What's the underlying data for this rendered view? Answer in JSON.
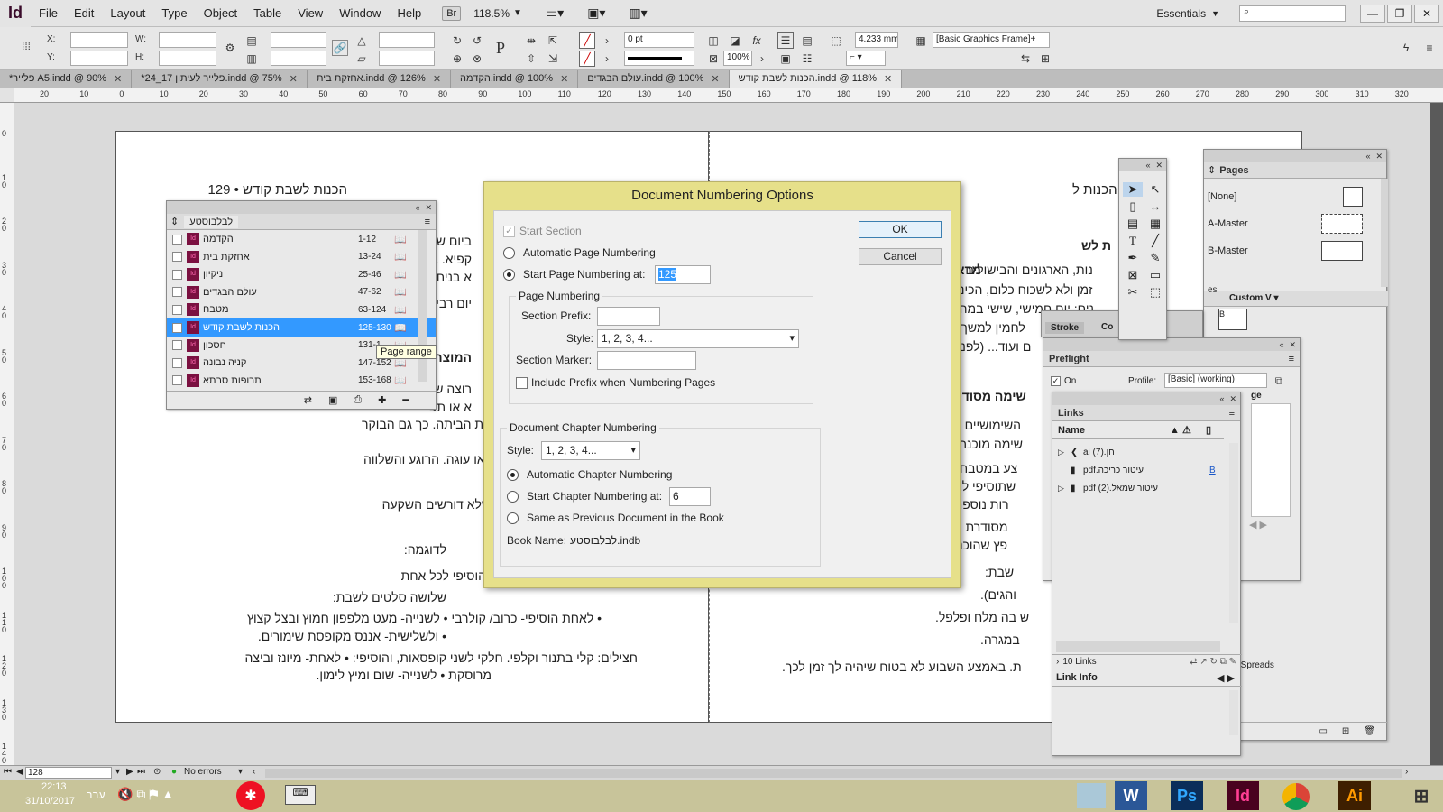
{
  "menubar": {
    "logo": "Id",
    "items": [
      "File",
      "Edit",
      "Layout",
      "Type",
      "Object",
      "Table",
      "View",
      "Window",
      "Help"
    ],
    "br_chip": "Br",
    "zoom": "118.5%",
    "workspace": "Essentials",
    "win_min": "—",
    "win_restore": "❐",
    "win_close": "✕"
  },
  "control": {
    "x_label": "X:",
    "y_label": "Y:",
    "w_label": "W:",
    "h_label": "H:",
    "stroke_weight": "0 pt",
    "opacity": "100%",
    "fitting_value": "4.233 mm",
    "object_style": "[Basic Graphics Frame]+"
  },
  "tabs": [
    {
      "label": "*פלייר A5.indd @ 90%",
      "active": false
    },
    {
      "label": "*24_17 פלייר לעיתון.indd @ 75%",
      "active": false
    },
    {
      "label": "אחזקת בית.indd @ 126%",
      "active": false
    },
    {
      "label": "הקדמה.indd @ 100%",
      "active": false
    },
    {
      "label": "עולם הבגדים.indd @ 100%",
      "active": false
    },
    {
      "label": "הכנות לשבת קודש.indd @ 118%",
      "active": true
    }
  ],
  "hruler": [
    "20",
    "10",
    "0",
    "10",
    "20",
    "30",
    "40",
    "50",
    "60",
    "70",
    "80",
    "90",
    "100",
    "110",
    "120",
    "130",
    "140",
    "150",
    "160",
    "170",
    "180",
    "190",
    "200",
    "210",
    "220",
    "230",
    "240",
    "250",
    "260",
    "270",
    "280",
    "290",
    "300",
    "310",
    "320"
  ],
  "vruler": [
    "0",
    "1 0",
    "2 0",
    "3 0",
    "4 0",
    "5 0",
    "6 0",
    "7 0",
    "8 0",
    "9 0",
    "1 0 0",
    "1 1 0",
    "1 2 0",
    "1 3 0",
    "1 4 0"
  ],
  "left_page": {
    "header": "הכנות לשבת קודש • 129",
    "lines": [
      "ביום שני",
      "קפיא. ביו",
      "א בניחור",
      "יום רביע",
      "המוצרים",
      "רוצה שי",
      "א או תפ",
      "לק בערך שעה לפני שאת חוזרת הביתה. כך גם הבוקר",
      "ים לפני כניסת שבת עוד סלט או עוגה. הרוגע והשלווה",
      "הדברים הפשוטים והרגילים, שלא דורשים השקעה",
      "לדוגמה:",
      "וכד') וחלקי לשלוש קופסאות, הוסיפי לכל אחת",
      "שלושה סלטים לשבת:",
      "• לאחת הוסיפי- כרוב/ קולרבי  • לשנייה- מעט מלפפון חמוץ ובצל קצוץ",
      "• ולשלישית- אננס מקופסת שימורים.",
      "חצילים: קלי בתנור וקלפי. חלקי לשני קופסאות, והוסיפי: • לאחת- מיונז וביצה",
      "מרוסקת • לשנייה- שום ומיץ לימון."
    ]
  },
  "right_page": {
    "header": "הכנות ל",
    "lines": [
      "ת לש",
      "מראש",
      "נות, הארגונים והבישולים לש",
      "זמן ולא לשכוח כלום, הכיני ר",
      "נים: יום חמישי, שישי במהלך",
      "לחמין למשך הי",
      "ם ועוד... (לפני ה",
      "שימה מסודרת",
      "השימושיים בב",
      "שימה מוכנה ש",
      "צע במטבח וכ",
      "שתוסיפי לרש",
      "רות נוספת -",
      "מסודרת של",
      "פץ שהוכנס.",
      "שבת:",
      "והגים).",
      "ש בה מלח ופלפל.",
      "במגרה.",
      "ת. באמצע השבוע לא בטוח שיהיה לך זמן לכך."
    ]
  },
  "book_panel": {
    "title": "לבלבוסטע",
    "docs": [
      {
        "name": "הקדמה",
        "range": "1-12",
        "selected": false
      },
      {
        "name": "אחזקת בית",
        "range": "13-24",
        "selected": false
      },
      {
        "name": "ניקיון",
        "range": "25-46",
        "selected": false
      },
      {
        "name": "עולם הבגדים",
        "range": "47-62",
        "selected": false
      },
      {
        "name": "מטבח",
        "range": "63-124",
        "selected": false
      },
      {
        "name": "הכנות לשבת קודש",
        "range": "125-130",
        "selected": true
      },
      {
        "name": "חסכון",
        "range": "131-1",
        "selected": false
      },
      {
        "name": "קניה נבונה",
        "range": "147-152",
        "selected": false
      },
      {
        "name": "תרופות סבתא",
        "range": "153-168",
        "selected": false
      }
    ],
    "tooltip": "Page range"
  },
  "dialog": {
    "title": "Document Numbering Options",
    "start_section": "Start Section",
    "automatic_page_numbering": "Automatic Page Numbering",
    "start_page_numbering_at": "Start Page Numbering at:",
    "start_page_value": "125",
    "page_numbering_group": "Page Numbering",
    "section_prefix": "Section Prefix:",
    "style": "Style:",
    "style_value": "1, 2, 3, 4...",
    "section_marker": "Section Marker:",
    "include_prefix": "Include Prefix when Numbering Pages",
    "chapter_group": "Document Chapter Numbering",
    "chapter_style_value": "1, 2, 3, 4...",
    "automatic_chapter_numbering": "Automatic Chapter Numbering",
    "start_chapter_numbering_at": "Start Chapter Numbering at:",
    "chapter_start_value": "6",
    "same_as_previous": "Same as Previous Document in the Book",
    "book_name_label": "Book Name:",
    "book_name": "לבלבוסטע.indb",
    "ok": "OK",
    "cancel": "Cancel"
  },
  "pages_panel": {
    "title": "Pages",
    "items": [
      "[None]",
      "A-Master",
      "B-Master"
    ],
    "custom": "Custom V",
    "spreads": "n 4 Spreads",
    "fragment": "es"
  },
  "stroke_panel": {
    "title": "Stroke",
    "fragment": "Co"
  },
  "preflight_panel": {
    "title": "Preflight",
    "on": "On",
    "profile_label": "Profile:",
    "profile": "[Basic] (working)",
    "fragment": "ge"
  },
  "links_panel": {
    "title": "Links",
    "col_name": "Name",
    "items": [
      {
        "name": "חן.ai (7)",
        "badge": ""
      },
      {
        "name": "עיטור כריכה.pdf",
        "badge": "B"
      },
      {
        "name": "עיטור שמאל.pdf (2)",
        "badge": ""
      }
    ],
    "count": "10 Links",
    "link_info": "Link Info"
  },
  "status": {
    "page": "128",
    "errors": "No errors"
  },
  "taskbar": {
    "time": "22:13",
    "date": "31/10/2017",
    "lang": "עבר",
    "apps": [
      {
        "name": "W",
        "color": "#2b5797"
      },
      {
        "name": "Ps",
        "color": "#0b2e5a"
      },
      {
        "name": "Id",
        "color": "#49021f"
      },
      {
        "name": "Ai",
        "color": "#3e1f00"
      }
    ]
  },
  "colors": {
    "accent": "#3399ff",
    "dialog_frame": "#e6e08a",
    "selection": "#3399ff"
  }
}
